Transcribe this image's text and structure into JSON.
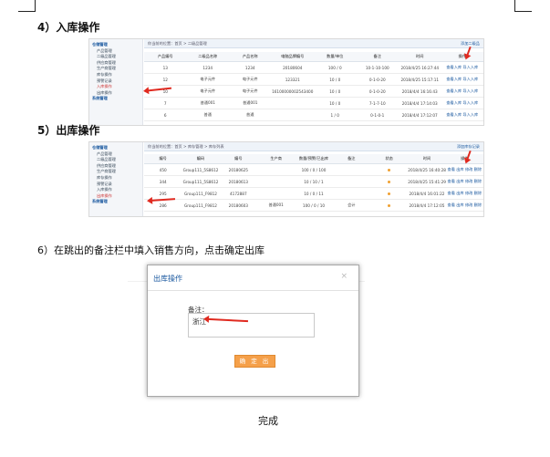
{
  "steps": {
    "step4": "4）入库操作",
    "step5": "5）出库操作",
    "step6": "6）在跳出的备注栏中填入销售方向，点击确定出库",
    "done": "完成"
  },
  "sidebar": {
    "items": [
      "仓储管理",
      "产品管理",
      "二级品管理",
      "供应商管理",
      "生产商管理",
      "库存操作",
      "预警记录",
      "入库操作",
      "出库操作",
      "系统管理"
    ],
    "active_in": "入库操作",
    "active_out": "出库操作"
  },
  "inbound": {
    "crumb": "你当前的位置：首页 > 二级品管理",
    "crumb_right": "添加二级品",
    "headers": [
      "产品编号",
      "二级品名称",
      "产品名称",
      "电脑品牌编号",
      "数量/单位",
      "备注",
      "时间",
      "操作"
    ],
    "rows": [
      [
        "13",
        "1234",
        "1234",
        "20180604",
        "100 / 0",
        "10-1-10-100",
        "2018/4/25 16:27:44",
        "查看入库  导入入库"
      ],
      [
        "12",
        "电子元件",
        "电子元件",
        "123321",
        "10 / 0",
        "0-1-0-20",
        "2018/4/25 15:17:11",
        "查看入库  导入入库"
      ],
      [
        "10",
        "电子元件",
        "电子元件",
        "16100000002543400",
        "10 / 0",
        "0-1-0-20",
        "2018/4/4 16:16:43",
        "查看入库  导入入库"
      ],
      [
        "7",
        "普通001",
        "普通001",
        "",
        "10 / 0",
        "7-1-7-10",
        "2018/4/4 17:14:03",
        "查看入库  导入入库"
      ],
      [
        "6",
        "普通",
        "普通",
        "",
        "1 / 0",
        "0-1-0-1",
        "2018/4/4 17:12:07",
        "查看入库  导入入库"
      ]
    ]
  },
  "outbound": {
    "crumb": "你当前的位置：首页 > 库存管理 > 库存列表",
    "crumb_right": "添加库存记录",
    "headers": [
      "编号",
      "编码",
      "编号",
      "生产商",
      "数量/预警/已出库",
      "备注",
      "状态",
      "时间",
      "操作"
    ],
    "rows": [
      [
        "450",
        "Group111_5S8612",
        "20180625",
        "",
        "100 / 0 / 100",
        "",
        "",
        "2018/4/25 16:40:28",
        "查看  出库  修改  删除"
      ],
      [
        "344",
        "Group111_5S8612",
        "20180613",
        "",
        "10 / 10 / 1",
        "",
        "",
        "2018/4/25 15:41:29",
        "查看  出库  修改  删除"
      ],
      [
        "295",
        "Group111_F9812",
        "4172887",
        "",
        "10 / 0 / 11",
        "",
        "",
        "2018/4/4 16:01:22",
        "查看  出库  修改  删除"
      ],
      [
        "286",
        "Group111_F9812",
        "20180603",
        "普通001",
        "100 / 0 / 10",
        "会计",
        "",
        "2018/4/4 17:12:05",
        "查看  出库  修改  删除"
      ]
    ]
  },
  "dialog": {
    "title": "出库操作",
    "close": "×",
    "label": "备注：",
    "value": "浙江",
    "confirm": "确 定 出 库"
  }
}
